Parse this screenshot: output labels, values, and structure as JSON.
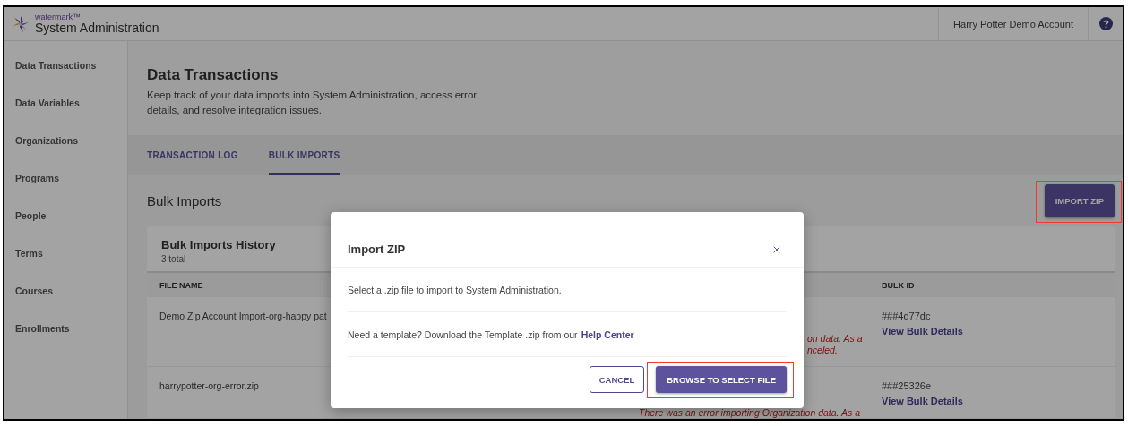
{
  "app": {
    "brand": "watermark",
    "trademark": "™",
    "title": "System Administration",
    "account": "Harry Potter Demo Account"
  },
  "sidebar": {
    "items": [
      {
        "label": "Data Transactions"
      },
      {
        "label": "Data Variables"
      },
      {
        "label": "Organizations"
      },
      {
        "label": "Programs"
      },
      {
        "label": "People"
      },
      {
        "label": "Terms"
      },
      {
        "label": "Courses"
      },
      {
        "label": "Enrollments"
      }
    ]
  },
  "page": {
    "title": "Data Transactions",
    "description": "Keep track of your data imports into System Administration, access error details, and resolve integration issues."
  },
  "tabs": [
    {
      "label": "TRANSACTION LOG",
      "selected": false
    },
    {
      "label": "BULK IMPORTS",
      "selected": true
    }
  ],
  "section": {
    "title": "Bulk Imports",
    "action": {
      "label": "IMPORT ZIP",
      "highlighted": true
    }
  },
  "history": {
    "title": "Bulk Imports History",
    "count": "3 total",
    "header": {
      "file_name": "FILE NAME",
      "bulk_id": "BULK ID"
    },
    "rows": [
      {
        "file_name": "Demo Zip Account Import-org-happy pat",
        "message": [
          "on data. As a",
          "nceled."
        ],
        "bulk_id": "###4d77dc",
        "link": "View Bulk Details"
      },
      {
        "file_name": "harrypotter-org-error.zip",
        "message": [
          "There was an error importing Organization data. As a"
        ],
        "bulk_id": "###25326e",
        "link": "View Bulk Details"
      }
    ]
  },
  "modal": {
    "title": "Import ZIP",
    "body": "Select a .zip file to import to System Administration.",
    "template_text": "Need a template? Download the Template .zip from our",
    "template_link": "Help Center",
    "buttons": [
      {
        "label": "CANCEL",
        "kind": "secondary",
        "highlighted": false
      },
      {
        "label": "BROWSE TO SELECT FILE",
        "kind": "primary",
        "highlighted": true
      }
    ]
  }
}
